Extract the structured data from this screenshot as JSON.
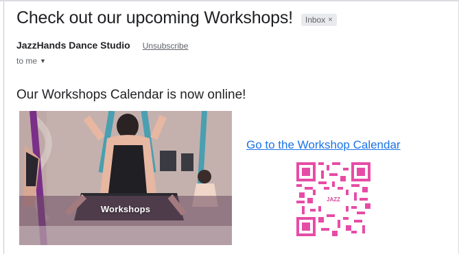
{
  "email": {
    "subject": "Check out our upcoming Workshops!",
    "label": "Inbox",
    "label_close": "×",
    "sender": "JazzHands Dance Studio",
    "unsubscribe": "Unsubscribe",
    "recipient": "to me",
    "recipient_caret": "▼"
  },
  "content": {
    "heading": "Our Workshops Calendar is now online!",
    "image_caption": "Workshops",
    "calendar_link": "Go to the Workshop Calendar",
    "qr_label": "JAZZ"
  },
  "colors": {
    "link": "#1a73e8",
    "qr": "#e64ca6",
    "silks": "#4a9fb0"
  }
}
